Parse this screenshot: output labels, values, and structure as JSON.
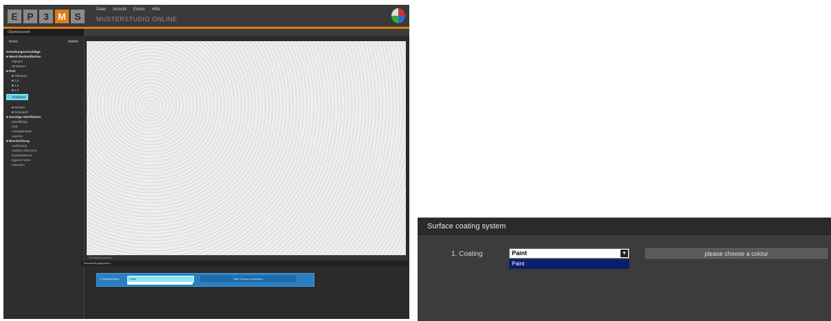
{
  "app": {
    "logo_letters": [
      "E",
      "P",
      "3",
      "M",
      "S"
    ],
    "top_menu": [
      "Datei",
      "Ansicht",
      "Extras",
      "Hilfe"
    ],
    "title": "MUSTERSTUDIO ONLINE",
    "sidebar": {
      "title": "Objektauswahl",
      "toggle_left": "Innen",
      "toggle_right": "Außen",
      "tree": [
        {
          "label": "Gestaltungsvorschläge",
          "type": "sec"
        },
        {
          "label": "■ Wand-/Deckenflächen",
          "type": "sec"
        },
        {
          "label": "Tapeten",
          "type": "item"
        },
        {
          "label": "Strukturen",
          "type": "item"
        },
        {
          "label": "■ Putz",
          "type": "sec"
        },
        {
          "label": "■ Oberputz",
          "type": "item"
        },
        {
          "label": "■ 1,5",
          "type": "item"
        },
        {
          "label": "■ 2,0",
          "type": "item"
        },
        {
          "label": "■ 3,0",
          "type": "item"
        },
        {
          "label": "Kratzputz",
          "type": "selected"
        },
        {
          "label": "■ Weitere",
          "type": "item"
        },
        {
          "label": "■ Dekorputz",
          "type": "item"
        },
        {
          "label": "■ Sonstige Oberflächen",
          "type": "sec"
        },
        {
          "label": "Wandbelag",
          "type": "item"
        },
        {
          "label": "Holz",
          "type": "item"
        },
        {
          "label": "Fassadenfarbe",
          "type": "item"
        },
        {
          "label": "Lasuren",
          "type": "item"
        },
        {
          "label": "■ Beschichtung",
          "type": "sec"
        },
        {
          "label": "Lackierung",
          "type": "item"
        },
        {
          "label": "Farbton-Übersicht",
          "type": "item"
        },
        {
          "label": "Kombinationen",
          "type": "item"
        },
        {
          "label": "Eigene Farbe",
          "type": "item"
        },
        {
          "label": "Favoriten",
          "type": "item"
        }
      ]
    },
    "viewer_caption": "Oberflächenansicht",
    "mini_panel": {
      "title": "Beschichtungssystem",
      "label": "1. Beschichtung",
      "select_value": "Farbe",
      "color_button": "Bitte Farbton auswählen"
    }
  },
  "zoom": {
    "title": "Surface coating system",
    "coating_label": "1. Coating",
    "select_value": "Paint",
    "options": [
      "Paint"
    ],
    "choose_colour": "please choose a colour"
  }
}
